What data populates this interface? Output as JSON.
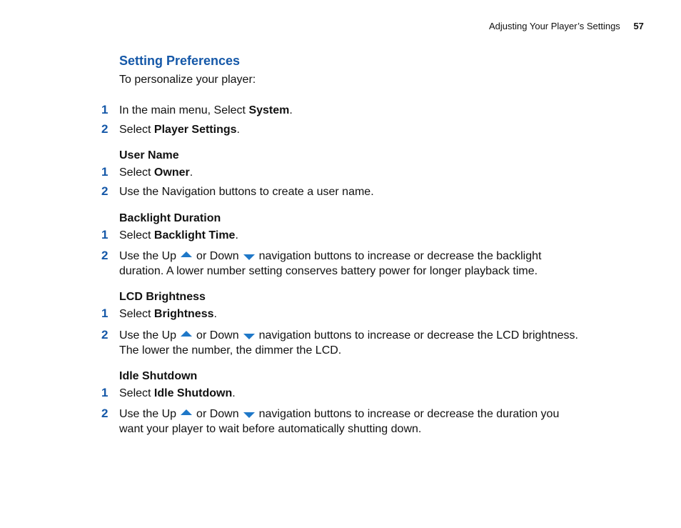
{
  "header": {
    "chapter_title": "Adjusting Your Player’s Settings",
    "page_number": "57"
  },
  "section": {
    "title": "Setting Preferences",
    "intro": "To personalize your player:",
    "accent_color": "#1558a8",
    "arrow_color": "#1f78c8"
  },
  "main_steps": [
    {
      "num": "1",
      "pre": "In the main menu, Select ",
      "bold": "System",
      "post": "."
    },
    {
      "num": "2",
      "pre": "Select ",
      "bold": "Player Settings",
      "post": "."
    }
  ],
  "user_name": {
    "heading": "User Name",
    "step1": {
      "num": "1",
      "pre": "Select ",
      "bold": "Owner",
      "post": "."
    },
    "step2": {
      "num": "2",
      "text": "Use the Navigation buttons to create a user name."
    }
  },
  "backlight": {
    "heading": "Backlight Duration",
    "step1": {
      "num": "1",
      "pre": "Select ",
      "bold": "Backlight Time",
      "post": "."
    },
    "step2": {
      "num": "2",
      "a": "Use the Up",
      "b": "or Down",
      "c": "navigation buttons to increase or decrease the backlight",
      "line2": "duration. A lower number setting conserves battery power for longer playback time."
    }
  },
  "lcd": {
    "heading": "LCD Brightness",
    "step1": {
      "num": "1",
      "pre": "Select ",
      "bold": "Brightness",
      "post": "."
    },
    "step2": {
      "num": "2",
      "a": "Use the Up",
      "b": "or Down",
      "c": "navigation buttons to increase or decrease the LCD brightness.",
      "line2": "The lower the number, the dimmer the LCD."
    }
  },
  "idle": {
    "heading": "Idle Shutdown",
    "step1": {
      "num": "1",
      "pre": "Select ",
      "bold": "Idle Shutdown",
      "post": "."
    },
    "step2": {
      "num": "2",
      "a": "Use the Up",
      "b": "or Down",
      "c": "navigation buttons to increase or decrease the duration you",
      "line2": "want your player to wait before automatically shutting down."
    }
  },
  "icons": {
    "up": "up-arrow-icon",
    "down": "down-arrow-icon"
  }
}
